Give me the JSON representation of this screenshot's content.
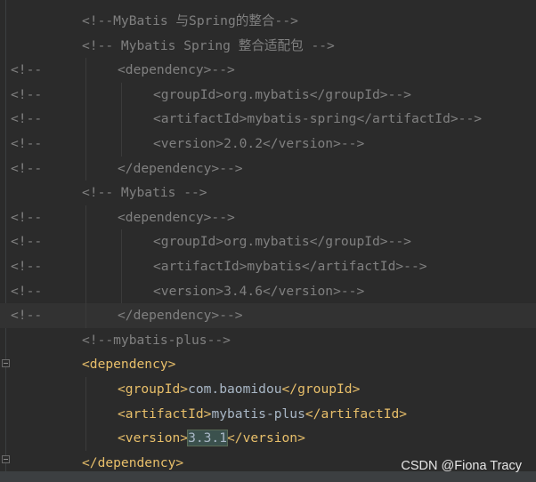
{
  "editor": {
    "lines": [
      {
        "prefix": "",
        "indent": 92,
        "segments": [
          {
            "cls": "cmt",
            "text": "<!--MyBatis 与Spring的整合-->"
          }
        ]
      },
      {
        "prefix": "",
        "indent": 92,
        "segments": [
          {
            "cls": "cmt",
            "text": "<!-- Mybatis Spring 整合适配包 -->"
          }
        ]
      },
      {
        "prefix": "<!--",
        "indent": 132,
        "segments": [
          {
            "cls": "cmt",
            "text": "<dependency>-->"
          }
        ]
      },
      {
        "prefix": "<!--",
        "indent": 172,
        "segments": [
          {
            "cls": "cmt",
            "text": "<groupId>org.mybatis</groupId>-->"
          }
        ]
      },
      {
        "prefix": "<!--",
        "indent": 172,
        "segments": [
          {
            "cls": "cmt",
            "text": "<artifactId>mybatis-spring</artifactId>-->"
          }
        ]
      },
      {
        "prefix": "<!--",
        "indent": 172,
        "segments": [
          {
            "cls": "cmt",
            "text": "<version>2.0.2</version>-->"
          }
        ]
      },
      {
        "prefix": "<!--",
        "indent": 132,
        "segments": [
          {
            "cls": "cmt",
            "text": "</dependency>-->"
          }
        ]
      },
      {
        "prefix": "",
        "indent": 92,
        "segments": [
          {
            "cls": "cmt",
            "text": "<!-- Mybatis -->"
          }
        ]
      },
      {
        "prefix": "<!--",
        "indent": 132,
        "segments": [
          {
            "cls": "cmt",
            "text": "<dependency>-->"
          }
        ]
      },
      {
        "prefix": "<!--",
        "indent": 172,
        "segments": [
          {
            "cls": "cmt",
            "text": "<groupId>org.mybatis</groupId>-->"
          }
        ]
      },
      {
        "prefix": "<!--",
        "indent": 172,
        "segments": [
          {
            "cls": "cmt",
            "text": "<artifactId>mybatis</artifactId>-->"
          }
        ]
      },
      {
        "prefix": "<!--",
        "indent": 172,
        "segments": [
          {
            "cls": "cmt",
            "text": "<version>3.4.6</version>-->"
          }
        ]
      },
      {
        "prefix": "<!--",
        "indent": 132,
        "current": true,
        "segments": [
          {
            "cls": "cmt",
            "text": "</dependency>-->"
          }
        ]
      },
      {
        "prefix": "",
        "indent": 92,
        "segments": [
          {
            "cls": "cmt",
            "text": "<!--mybatis-plus-->"
          }
        ]
      },
      {
        "prefix": "",
        "indent": 92,
        "segments": [
          {
            "cls": "tag",
            "text": "<dependency>"
          }
        ]
      },
      {
        "prefix": "",
        "indent": 132,
        "segments": [
          {
            "cls": "tag",
            "text": "<groupId>"
          },
          {
            "cls": "txt",
            "text": "com.baomidou"
          },
          {
            "cls": "tag",
            "text": "</groupId>"
          }
        ]
      },
      {
        "prefix": "",
        "indent": 132,
        "segments": [
          {
            "cls": "tag",
            "text": "<artifactId>"
          },
          {
            "cls": "txt",
            "text": "mybatis-plus"
          },
          {
            "cls": "tag",
            "text": "</artifactId>"
          }
        ]
      },
      {
        "prefix": "",
        "indent": 132,
        "segments": [
          {
            "cls": "tag",
            "text": "<version>"
          },
          {
            "cls": "txt hl",
            "text": "3.3.1"
          },
          {
            "cls": "tag",
            "text": "</version>"
          }
        ]
      },
      {
        "prefix": "",
        "indent": 92,
        "segments": [
          {
            "cls": "tag",
            "text": "</dependency>"
          }
        ]
      }
    ]
  },
  "watermark": "CSDN @Fiona Tracy"
}
